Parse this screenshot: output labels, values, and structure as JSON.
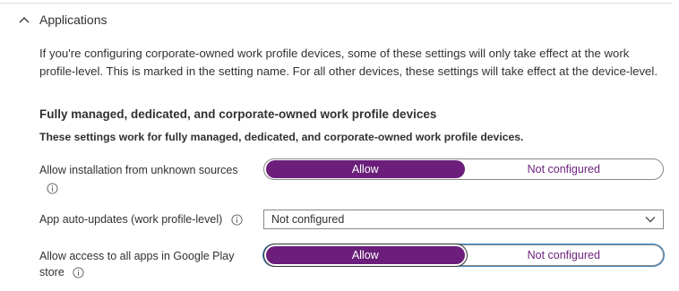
{
  "section": {
    "title": "Applications",
    "description": "If you're configuring corporate-owned work profile devices, some of these settings will only take effect at the work profile-level. This is marked in the setting name. For all other devices, these settings will take effect at the device-level."
  },
  "group": {
    "heading": "Fully managed, dedicated, and corporate-owned work profile devices",
    "subheading": "These settings work for fully managed, dedicated, and corporate-owned work profile devices."
  },
  "settings": {
    "unknown_sources": {
      "label": "Allow installation from unknown sources",
      "option_allow": "Allow",
      "option_not_configured": "Not configured",
      "selected": "Allow"
    },
    "auto_updates": {
      "label": "App auto-updates (work profile-level)",
      "value": "Not configured"
    },
    "google_play": {
      "label": "Allow access to all apps in Google Play store",
      "option_allow": "Allow",
      "option_not_configured": "Not configured",
      "selected": "Allow"
    }
  },
  "icons": {
    "collapse": "chevron-up-icon",
    "info": "info-icon",
    "dropdown": "chevron-down-icon"
  },
  "colors": {
    "accent": "#6b1f7b",
    "text": "#323130",
    "border": "#8a8886"
  }
}
